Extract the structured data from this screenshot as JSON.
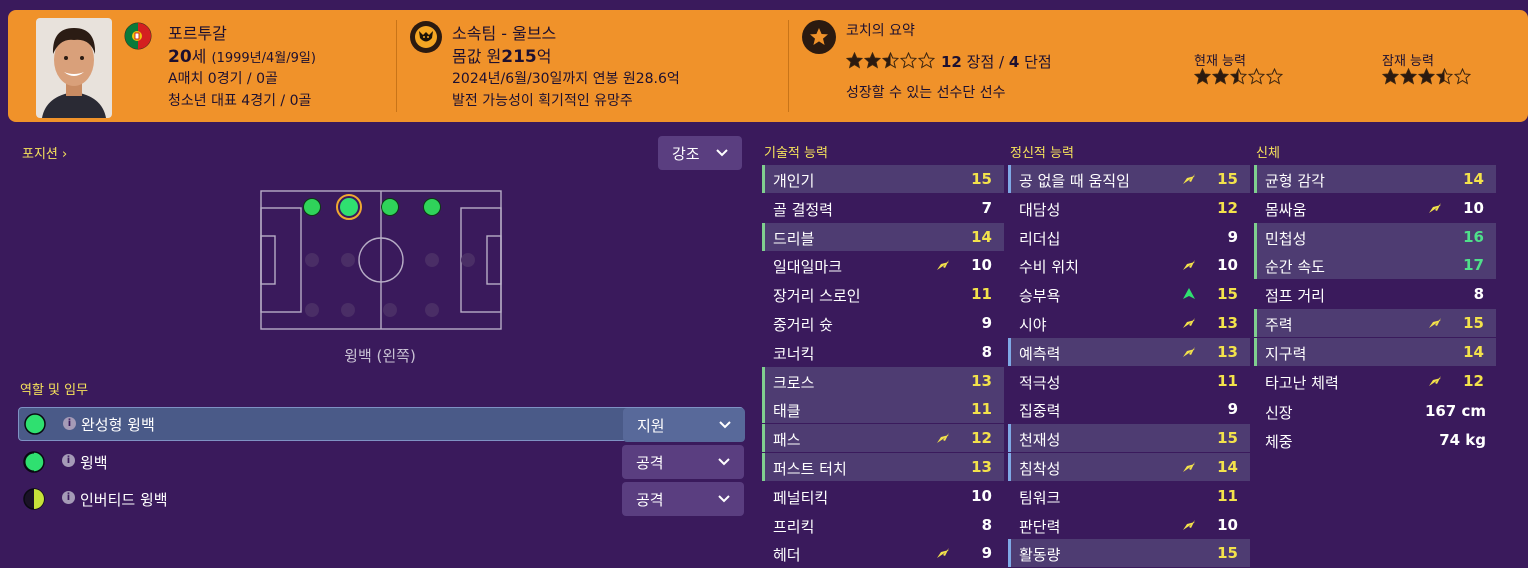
{
  "header": {
    "nationality": "포르투갈",
    "age_value": "20",
    "age_unit": "세",
    "birthdate": "(1999년/4월/9일)",
    "caps": "A매치 0경기 / 0골",
    "youth_caps": "청소년 대표 4경기 / 0골",
    "club_label": "소속팀 - 울브스",
    "value_prefix": "몸값 원",
    "value_number": "215",
    "value_suffix": "억",
    "contract": "2024년/6월/30일까지 연봉 원28.6억",
    "potential_text": "발전 가능성이 획기적인 유망주",
    "coach_title": "코치의 요약",
    "coach_summary_stars": 2.5,
    "strengths_count": "12",
    "strengths_label": "장점",
    "slash": "/",
    "weaknesses_count": "4",
    "weaknesses_label": "단점",
    "coach_note": "성장할 수 있는 선수단 선수",
    "current_ability_label": "현재 능력",
    "current_ability_stars": 2.5,
    "potential_ability_label": "잠재 능력",
    "potential_ability_stars": 3.5
  },
  "left": {
    "position_link": "포지션",
    "emphasis_label": "강조",
    "pitch_position_label": "윙백 (왼쪽)",
    "roles_title": "역할 및 임무",
    "roles": [
      {
        "name": "완성형 윙백",
        "duty": "지원",
        "selected": true
      },
      {
        "name": "윙백",
        "duty": "공격",
        "selected": false
      },
      {
        "name": "인버티드 윙백",
        "duty": "공격",
        "selected": false
      }
    ]
  },
  "colors": {
    "header_bg": "#f0922a",
    "page_bg": "#3a1a5c",
    "accent_yellow": "#f3e24b",
    "accent_green": "#4fe08a"
  },
  "technical": {
    "title": "기술적 능력",
    "attrs": [
      {
        "name": "개인기",
        "value": "15",
        "hl": true,
        "trend": ""
      },
      {
        "name": "골 결정력",
        "value": "7",
        "hl": false,
        "trend": ""
      },
      {
        "name": "드리블",
        "value": "14",
        "hl": true,
        "trend": ""
      },
      {
        "name": "일대일마크",
        "value": "10",
        "hl": false,
        "trend": "up-yellow"
      },
      {
        "name": "장거리 스로인",
        "value": "11",
        "hl": false,
        "trend": ""
      },
      {
        "name": "중거리 슛",
        "value": "9",
        "hl": false,
        "trend": ""
      },
      {
        "name": "코너킥",
        "value": "8",
        "hl": false,
        "trend": ""
      },
      {
        "name": "크로스",
        "value": "13",
        "hl": true,
        "trend": ""
      },
      {
        "name": "태클",
        "value": "11",
        "hl": true,
        "trend": ""
      },
      {
        "name": "패스",
        "value": "12",
        "hl": true,
        "trend": "up-yellow"
      },
      {
        "name": "퍼스트 터치",
        "value": "13",
        "hl": true,
        "trend": ""
      },
      {
        "name": "페널티킥",
        "value": "10",
        "hl": false,
        "trend": ""
      },
      {
        "name": "프리킥",
        "value": "8",
        "hl": false,
        "trend": ""
      },
      {
        "name": "헤더",
        "value": "9",
        "hl": false,
        "trend": "up-yellow"
      }
    ]
  },
  "mental": {
    "title": "정신적 능력",
    "attrs": [
      {
        "name": "공 없을 때 움직임",
        "value": "15",
        "hl": true,
        "trend": "up-yellow"
      },
      {
        "name": "대담성",
        "value": "12",
        "hl": false,
        "trend": ""
      },
      {
        "name": "리더십",
        "value": "9",
        "hl": false,
        "trend": ""
      },
      {
        "name": "수비 위치",
        "value": "10",
        "hl": false,
        "trend": "up-yellow"
      },
      {
        "name": "승부욕",
        "value": "15",
        "hl": false,
        "trend": "up-green"
      },
      {
        "name": "시야",
        "value": "13",
        "hl": false,
        "trend": "up-yellow"
      },
      {
        "name": "예측력",
        "value": "13",
        "hl": true,
        "trend": "up-yellow"
      },
      {
        "name": "적극성",
        "value": "11",
        "hl": false,
        "trend": ""
      },
      {
        "name": "집중력",
        "value": "9",
        "hl": false,
        "trend": ""
      },
      {
        "name": "천재성",
        "value": "15",
        "hl": true,
        "trend": ""
      },
      {
        "name": "침착성",
        "value": "14",
        "hl": true,
        "trend": "up-yellow"
      },
      {
        "name": "팀워크",
        "value": "11",
        "hl": false,
        "trend": ""
      },
      {
        "name": "판단력",
        "value": "10",
        "hl": false,
        "trend": "up-yellow"
      },
      {
        "name": "활동량",
        "value": "15",
        "hl": true,
        "trend": ""
      }
    ]
  },
  "physical": {
    "title": "신체",
    "attrs": [
      {
        "name": "균형 감각",
        "value": "14",
        "hl": true,
        "trend": ""
      },
      {
        "name": "몸싸움",
        "value": "10",
        "hl": false,
        "trend": "up-yellow"
      },
      {
        "name": "민첩성",
        "value": "16",
        "hl": true,
        "trend": ""
      },
      {
        "name": "순간 속도",
        "value": "17",
        "hl": true,
        "trend": ""
      },
      {
        "name": "점프 거리",
        "value": "8",
        "hl": false,
        "trend": ""
      },
      {
        "name": "주력",
        "value": "15",
        "hl": true,
        "trend": "up-yellow"
      },
      {
        "name": "지구력",
        "value": "14",
        "hl": true,
        "trend": ""
      },
      {
        "name": "타고난 체력",
        "value": "12",
        "hl": false,
        "trend": "up-yellow"
      }
    ],
    "height_label": "신장",
    "height_value": "167 cm",
    "weight_label": "체중",
    "weight_value": "74 kg"
  }
}
